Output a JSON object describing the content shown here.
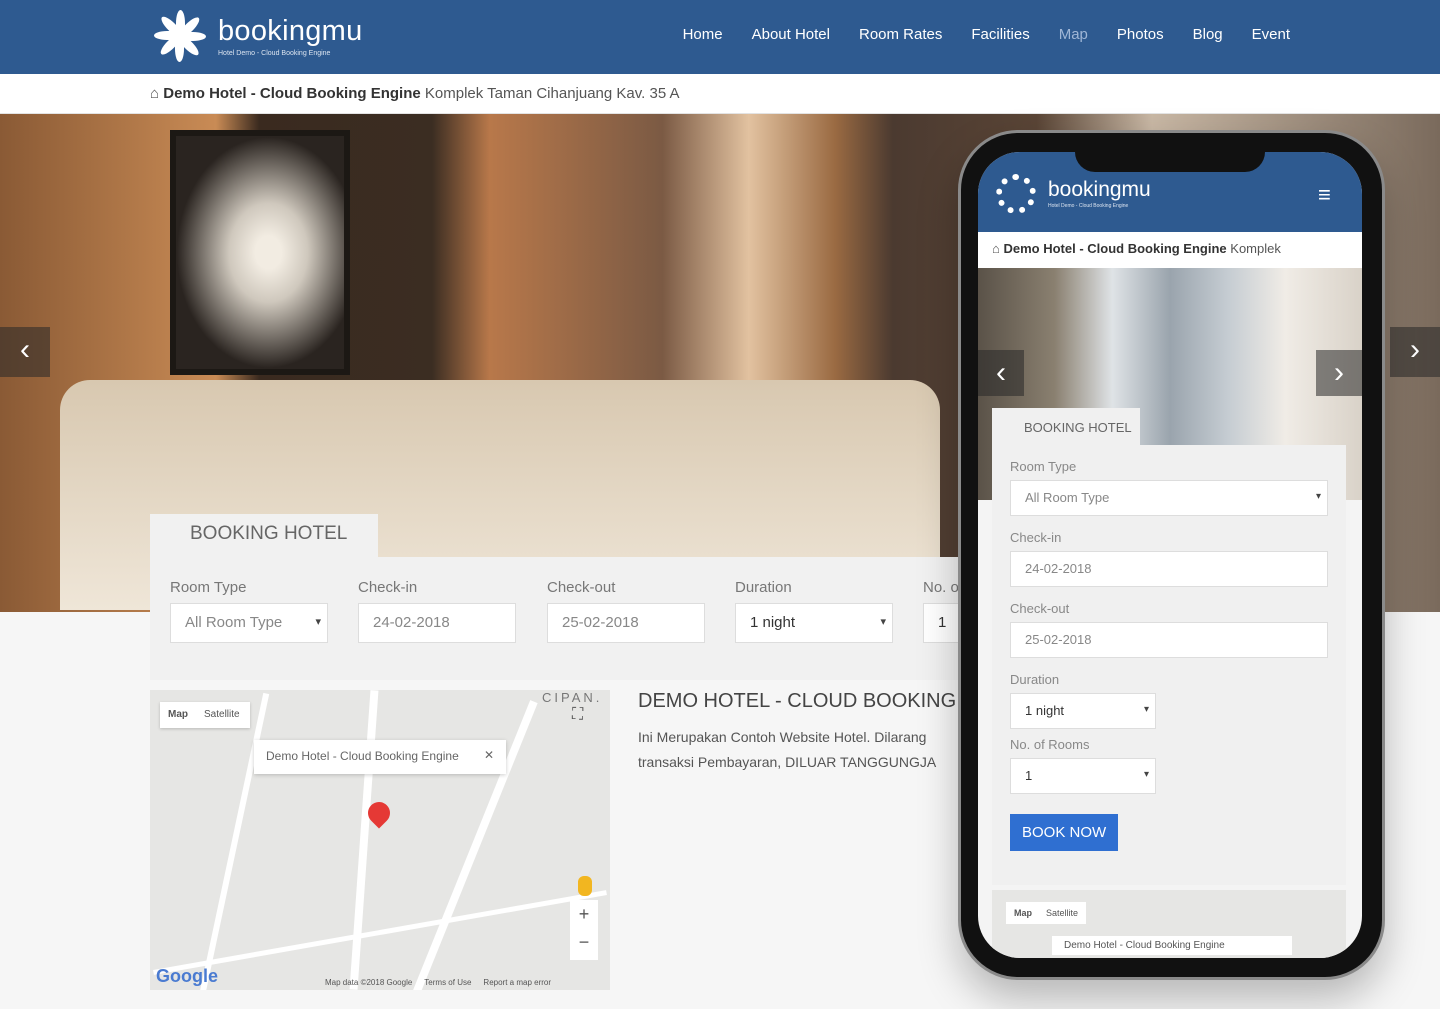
{
  "header": {
    "brand": "bookingmu",
    "tagline": "Hotel Demo - Cloud Booking Engine",
    "nav": [
      "Home",
      "About Hotel",
      "Room Rates",
      "Facilities",
      "Map",
      "Photos",
      "Blog",
      "Event"
    ],
    "active_nav": "Map",
    "color": "#2e5a90"
  },
  "breadcrumb": {
    "hotel": "Demo Hotel - Cloud Booking Engine",
    "address": "Komplek Taman Cihanjuang Kav. 35 A"
  },
  "booking": {
    "title": "BOOKING HOTEL",
    "room_type_label": "Room Type",
    "room_type": "All Room Type",
    "checkin_label": "Check-in",
    "checkin": "24-02-2018",
    "checkout_label": "Check-out",
    "checkout": "25-02-2018",
    "duration_label": "Duration",
    "duration": "1 night",
    "rooms_label": "No. o",
    "rooms": "1"
  },
  "map": {
    "tab_map": "Map",
    "tab_satellite": "Satellite",
    "popup": "Demo Hotel - Cloud Booking Engine",
    "area": "CIPAN.",
    "attribution": "Map data ©2018 Google",
    "terms": "Terms of Use",
    "report": "Report a map error",
    "google": "Google",
    "zoom_in": "+",
    "zoom_out": "−"
  },
  "description": {
    "title": "DEMO HOTEL - CLOUD BOOKING",
    "text1": "Ini Merupakan Contoh Website Hotel. Dilarang",
    "text2": "transaksi Pembayaran, DILUAR TANGGUNGJA"
  },
  "phone": {
    "brand": "bookingmu",
    "tagline": "Hotel Demo - Cloud Booking Engine",
    "crumb_hotel": "Demo Hotel - Cloud Booking Engine",
    "crumb_address": "Komplek",
    "booking_title": "BOOKING HOTEL",
    "room_type_label": "Room Type",
    "room_type": "All Room Type",
    "checkin_label": "Check-in",
    "checkin": "24-02-2018",
    "checkout_label": "Check-out",
    "checkout": "25-02-2018",
    "duration_label": "Duration",
    "duration": "1 night",
    "rooms_label": "No. of Rooms",
    "rooms": "1",
    "book_now": "BOOK NOW",
    "map_tab": "Map",
    "satellite_tab": "Satellite",
    "map_popup": "Demo Hotel - Cloud Booking Engine",
    "accent": "#2f6fd1"
  }
}
